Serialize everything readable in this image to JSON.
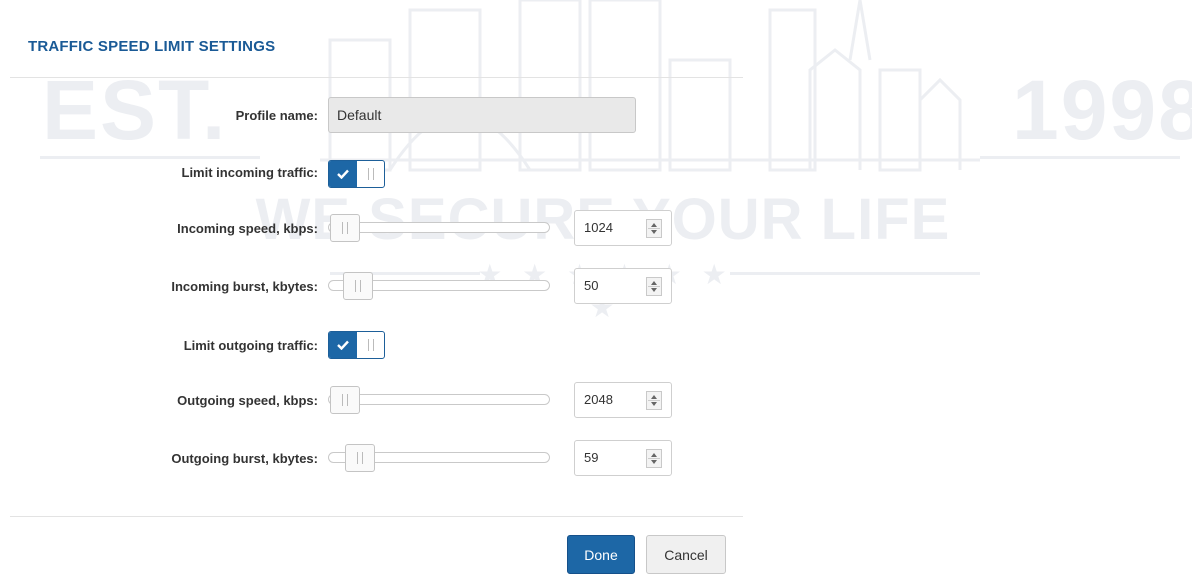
{
  "dialog": {
    "title": "TRAFFIC SPEED LIMIT SETTINGS"
  },
  "watermark": {
    "left_text": "EST.",
    "right_text": "1998",
    "slogan": "WE SECURE YOUR LIFE",
    "stars": "★ ★ ★ ★ ★ ★ ★"
  },
  "fields": {
    "profile_name": {
      "label": "Profile name:",
      "value": "Default"
    },
    "limit_incoming": {
      "label": "Limit incoming traffic:",
      "checked": true
    },
    "incoming_speed": {
      "label": "Incoming speed, kbps:",
      "value": "1024"
    },
    "incoming_burst": {
      "label": "Incoming burst, kbytes:",
      "value": "50"
    },
    "limit_outgoing": {
      "label": "Limit outgoing traffic:",
      "checked": true
    },
    "outgoing_speed": {
      "label": "Outgoing speed, kbps:",
      "value": "2048"
    },
    "outgoing_burst": {
      "label": "Outgoing burst, kbytes:",
      "value": "59"
    }
  },
  "sliders": {
    "incoming_speed_level": 0.0,
    "incoming_burst_level": 0.07,
    "outgoing_speed_level": 0.0,
    "outgoing_burst_level": 0.08
  },
  "buttons": {
    "done": "Done",
    "cancel": "Cancel"
  },
  "colors": {
    "accent": "#1d67a6",
    "title": "#1a5a96",
    "watermark": "#eceef2"
  },
  "icons": {
    "toggle_check": "check-icon",
    "spinner": "spinner-arrows-icon",
    "grip": "grip-icon"
  }
}
